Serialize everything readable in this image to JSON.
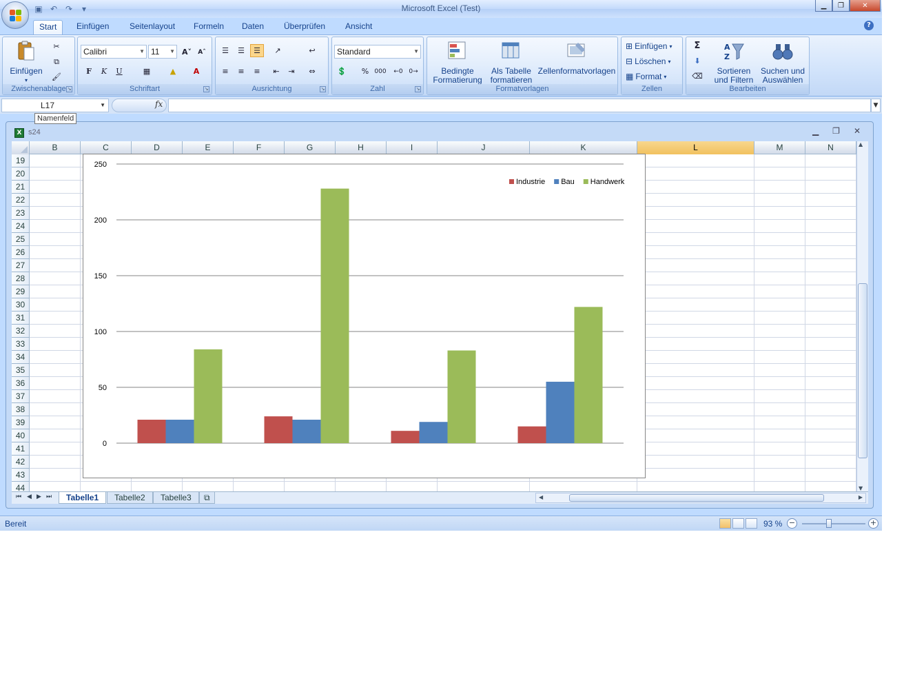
{
  "window": {
    "title": "Microsoft Excel (Test)"
  },
  "tabs": [
    "Start",
    "Einfügen",
    "Seitenlayout",
    "Formeln",
    "Daten",
    "Überprüfen",
    "Ansicht"
  ],
  "ribbon": {
    "clipboard": {
      "label": "Zwischenablage",
      "paste": "Einfügen"
    },
    "font": {
      "label": "Schriftart",
      "font_name": "Calibri",
      "font_size": "11",
      "bold": "F",
      "italic": "K",
      "underline": "U"
    },
    "alignment": {
      "label": "Ausrichtung"
    },
    "number": {
      "label": "Zahl",
      "format": "Standard",
      "percent": "%",
      "thousands": "000"
    },
    "styles": {
      "label": "Formatvorlagen",
      "conditional_l1": "Bedingte",
      "conditional_l2": "Formatierung",
      "as_table_l1": "Als Tabelle",
      "as_table_l2": "formatieren",
      "cell_styles": "Zellenformatvorlagen"
    },
    "cells": {
      "label": "Zellen",
      "insert": "Einfügen",
      "delete": "Löschen",
      "format": "Format"
    },
    "editing": {
      "label": "Bearbeiten",
      "sort_l1": "Sortieren",
      "sort_l2": "und Filtern",
      "find_l1": "Suchen und",
      "find_l2": "Auswählen"
    }
  },
  "formula_bar": {
    "name_box": "L17",
    "fx": "fx",
    "formula": ""
  },
  "tooltip": "Namenfeld",
  "workbook": {
    "name": "s24"
  },
  "columns": [
    "B",
    "C",
    "D",
    "E",
    "F",
    "G",
    "H",
    "I",
    "J",
    "K",
    "L",
    "M",
    "N"
  ],
  "selected_column": "L",
  "rows": [
    "19",
    "20",
    "21",
    "22",
    "23",
    "24",
    "25",
    "26",
    "27",
    "28",
    "29",
    "30",
    "31",
    "32",
    "33",
    "34",
    "35",
    "36",
    "37",
    "38",
    "39",
    "40",
    "41",
    "42",
    "43",
    "44"
  ],
  "sheets": [
    "Tabelle1",
    "Tabelle2",
    "Tabelle3"
  ],
  "active_sheet": "Tabelle1",
  "status": {
    "text": "Bereit",
    "zoom": "93 %"
  },
  "colors": {
    "industrie": "#c0504d",
    "bau": "#4f81bd",
    "handwerk": "#9bbb59"
  },
  "chart_data": {
    "type": "bar",
    "categories": [
      "",
      "",
      "",
      ""
    ],
    "series": [
      {
        "name": "Industrie",
        "values": [
          21,
          24,
          11,
          15
        ]
      },
      {
        "name": "Bau",
        "values": [
          21,
          21,
          19,
          55
        ]
      },
      {
        "name": "Handwerk",
        "values": [
          84,
          228,
          83,
          122
        ]
      }
    ],
    "title": "",
    "xlabel": "",
    "ylabel": "",
    "ylim": [
      0,
      250
    ],
    "yticks": [
      0,
      50,
      100,
      150,
      200,
      250
    ],
    "grid": true,
    "legend": "top-right"
  }
}
